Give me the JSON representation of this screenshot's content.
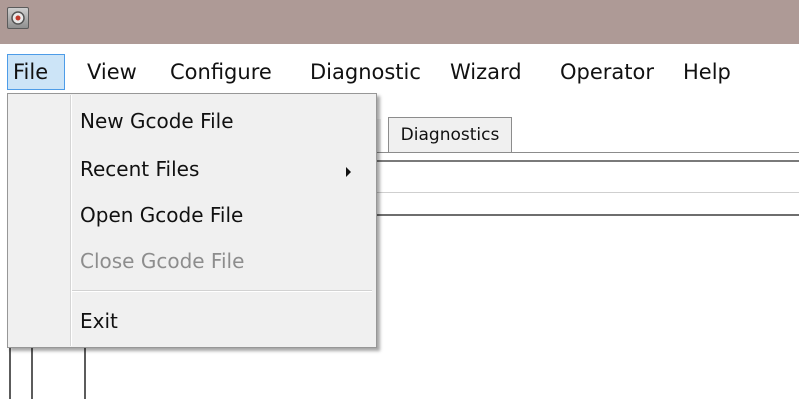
{
  "menubar": {
    "items": [
      {
        "label": "File"
      },
      {
        "label": "View"
      },
      {
        "label": "Configure"
      },
      {
        "label": "Diagnostic"
      },
      {
        "label": "Wizard"
      },
      {
        "label": "Operator"
      },
      {
        "label": "Help"
      }
    ]
  },
  "file_menu": {
    "items": [
      {
        "label": "New Gcode File",
        "enabled": true
      },
      {
        "label": "Recent Files",
        "enabled": true,
        "has_submenu": true
      },
      {
        "label": "Open Gcode File",
        "enabled": true
      },
      {
        "label": "Close Gcode File",
        "enabled": false
      },
      {
        "label": "Exit",
        "enabled": true
      }
    ]
  },
  "tabs": [
    {
      "label": "Diagnostics"
    }
  ],
  "icons": {
    "app": "app-icon",
    "submenu": "chevron-right-icon"
  },
  "colors": {
    "titlebar": "#ae9a96",
    "menu_highlight_bg": "#cce4f7",
    "menu_highlight_border": "#4d9ce8",
    "disabled_text": "#8d8d8d"
  }
}
